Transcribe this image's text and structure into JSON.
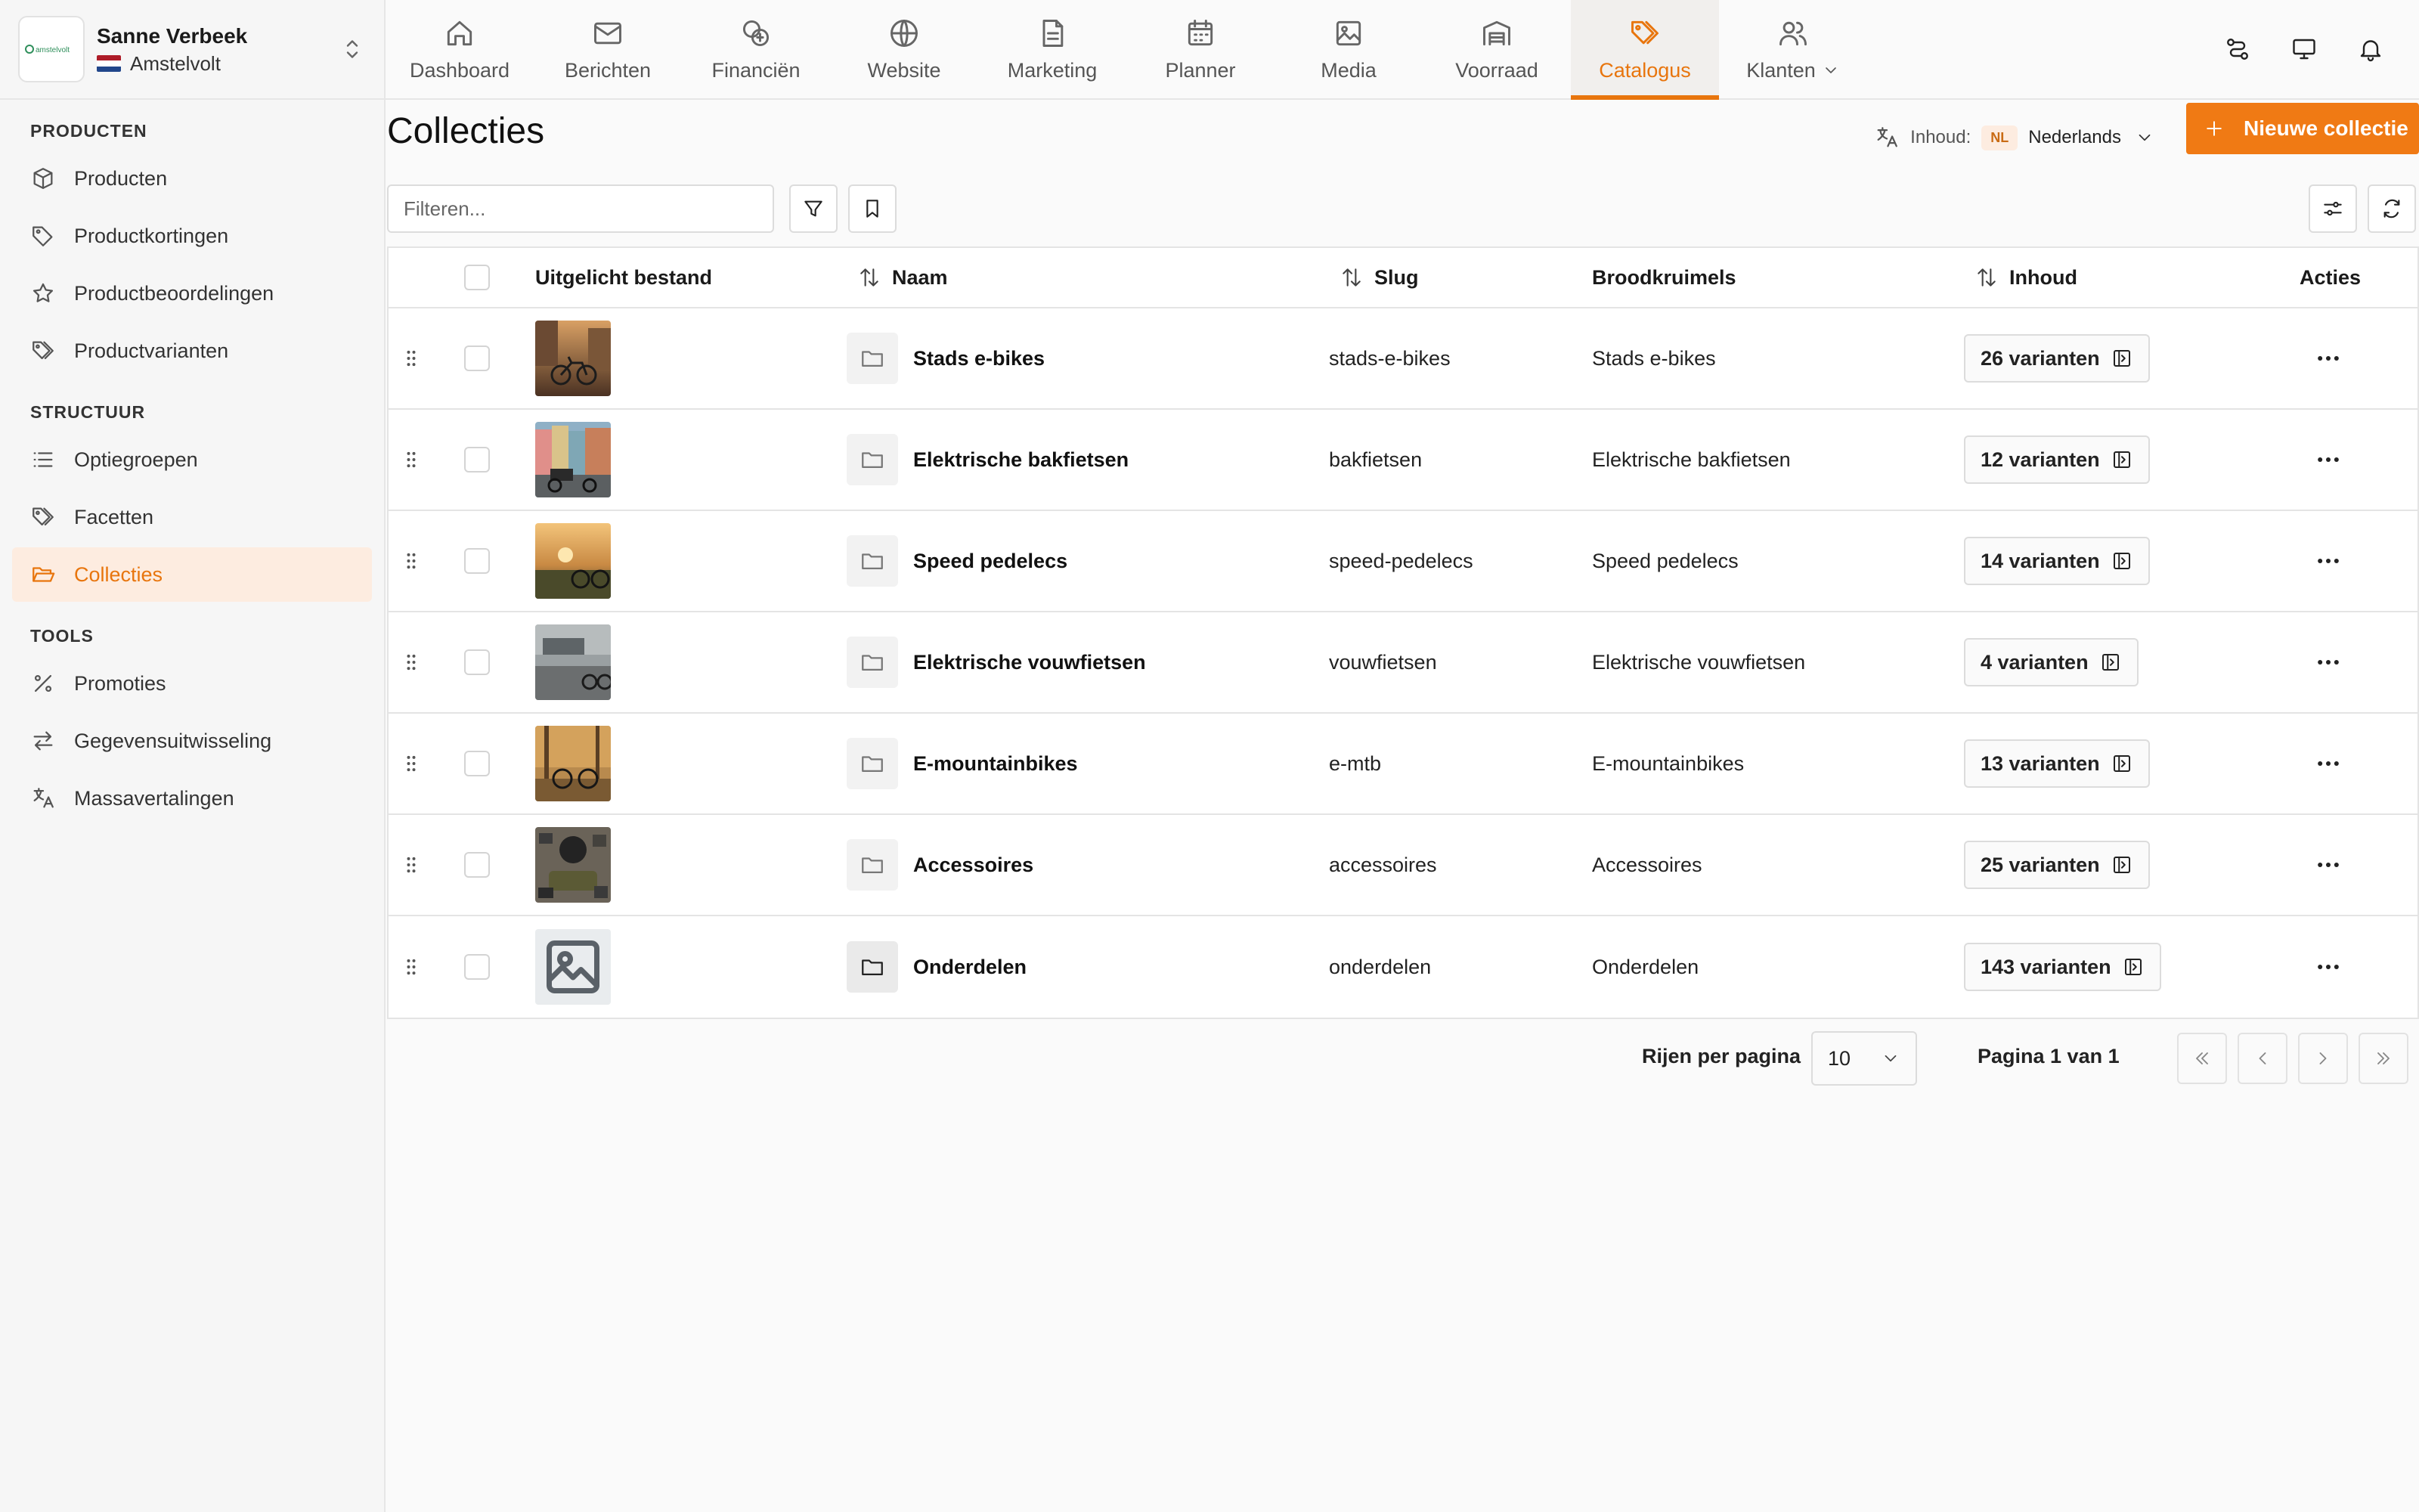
{
  "account": {
    "name": "Sanne Verbeek",
    "store": "Amstelvolt",
    "logo_text": "amstelvolt"
  },
  "sidebar": {
    "sections": [
      {
        "title": "PRODUCTEN",
        "items": [
          {
            "label": "Producten",
            "icon": "cube-icon"
          },
          {
            "label": "Productkortingen",
            "icon": "tag-icon"
          },
          {
            "label": "Productbeoordelingen",
            "icon": "star-icon"
          },
          {
            "label": "Productvarianten",
            "icon": "tags-icon"
          }
        ]
      },
      {
        "title": "STRUCTUUR",
        "items": [
          {
            "label": "Optiegroepen",
            "icon": "list-icon"
          },
          {
            "label": "Facetten",
            "icon": "tags-icon"
          },
          {
            "label": "Collecties",
            "icon": "folder-open-icon",
            "active": true
          }
        ]
      },
      {
        "title": "TOOLS",
        "items": [
          {
            "label": "Promoties",
            "icon": "percent-icon"
          },
          {
            "label": "Gegevensuitwisseling",
            "icon": "arrows-exchange-icon"
          },
          {
            "label": "Massavertalingen",
            "icon": "translate-icon"
          }
        ]
      }
    ]
  },
  "topnav": {
    "tabs": [
      {
        "label": "Dashboard",
        "icon": "home-icon"
      },
      {
        "label": "Berichten",
        "icon": "mail-icon"
      },
      {
        "label": "Financiën",
        "icon": "coins-icon"
      },
      {
        "label": "Website",
        "icon": "globe-icon"
      },
      {
        "label": "Marketing",
        "icon": "document-icon"
      },
      {
        "label": "Planner",
        "icon": "calendar-icon"
      },
      {
        "label": "Media",
        "icon": "image-icon"
      },
      {
        "label": "Voorraad",
        "icon": "warehouse-icon"
      },
      {
        "label": "Catalogus",
        "icon": "tags-icon",
        "active": true
      },
      {
        "label": "Klanten",
        "icon": "users-icon",
        "dropdown": true
      }
    ],
    "actions": [
      "route-icon",
      "monitor-icon",
      "bell-icon"
    ]
  },
  "page": {
    "title": "Collecties",
    "content_language_label": "Inhoud:",
    "language_code": "NL",
    "language_name": "Nederlands",
    "new_button": "Nieuwe collectie",
    "filter_placeholder": "Filteren..."
  },
  "table": {
    "columns": {
      "featured": "Uitgelicht bestand",
      "name": "Naam",
      "slug": "Slug",
      "breadcrumbs": "Broodkruimels",
      "content": "Inhoud",
      "actions": "Acties"
    },
    "rows": [
      {
        "name": "Stads e-bikes",
        "slug": "stads-e-bikes",
        "breadcrumb": "Stads e-bikes",
        "variants": "26 varianten",
        "thumb": "city"
      },
      {
        "name": "Elektrische bakfietsen",
        "slug": "bakfietsen",
        "breadcrumb": "Elektrische bakfietsen",
        "variants": "12 varianten",
        "thumb": "cargo"
      },
      {
        "name": "Speed pedelecs",
        "slug": "speed-pedelecs",
        "breadcrumb": "Speed pedelecs",
        "variants": "14 varianten",
        "thumb": "sunset"
      },
      {
        "name": "Elektrische vouwfietsen",
        "slug": "vouwfietsen",
        "breadcrumb": "Elektrische vouwfietsen",
        "variants": "4 varianten",
        "thumb": "folding"
      },
      {
        "name": "E-mountainbikes",
        "slug": "e-mtb",
        "breadcrumb": "E-mountainbikes",
        "variants": "13 varianten",
        "thumb": "forest"
      },
      {
        "name": "Accessoires",
        "slug": "accessoires",
        "breadcrumb": "Accessoires",
        "variants": "25 varianten",
        "thumb": "gear"
      },
      {
        "name": "Onderdelen",
        "slug": "onderdelen",
        "breadcrumb": "Onderdelen",
        "variants": "143 varianten",
        "thumb": "placeholder"
      }
    ]
  },
  "pagination": {
    "rows_per_page_label": "Rijen per pagina",
    "rows_per_page": "10",
    "page_info": "Pagina 1 van 1"
  },
  "colors": {
    "accent": "#f07a14",
    "accent_soft": "#fdece0"
  }
}
